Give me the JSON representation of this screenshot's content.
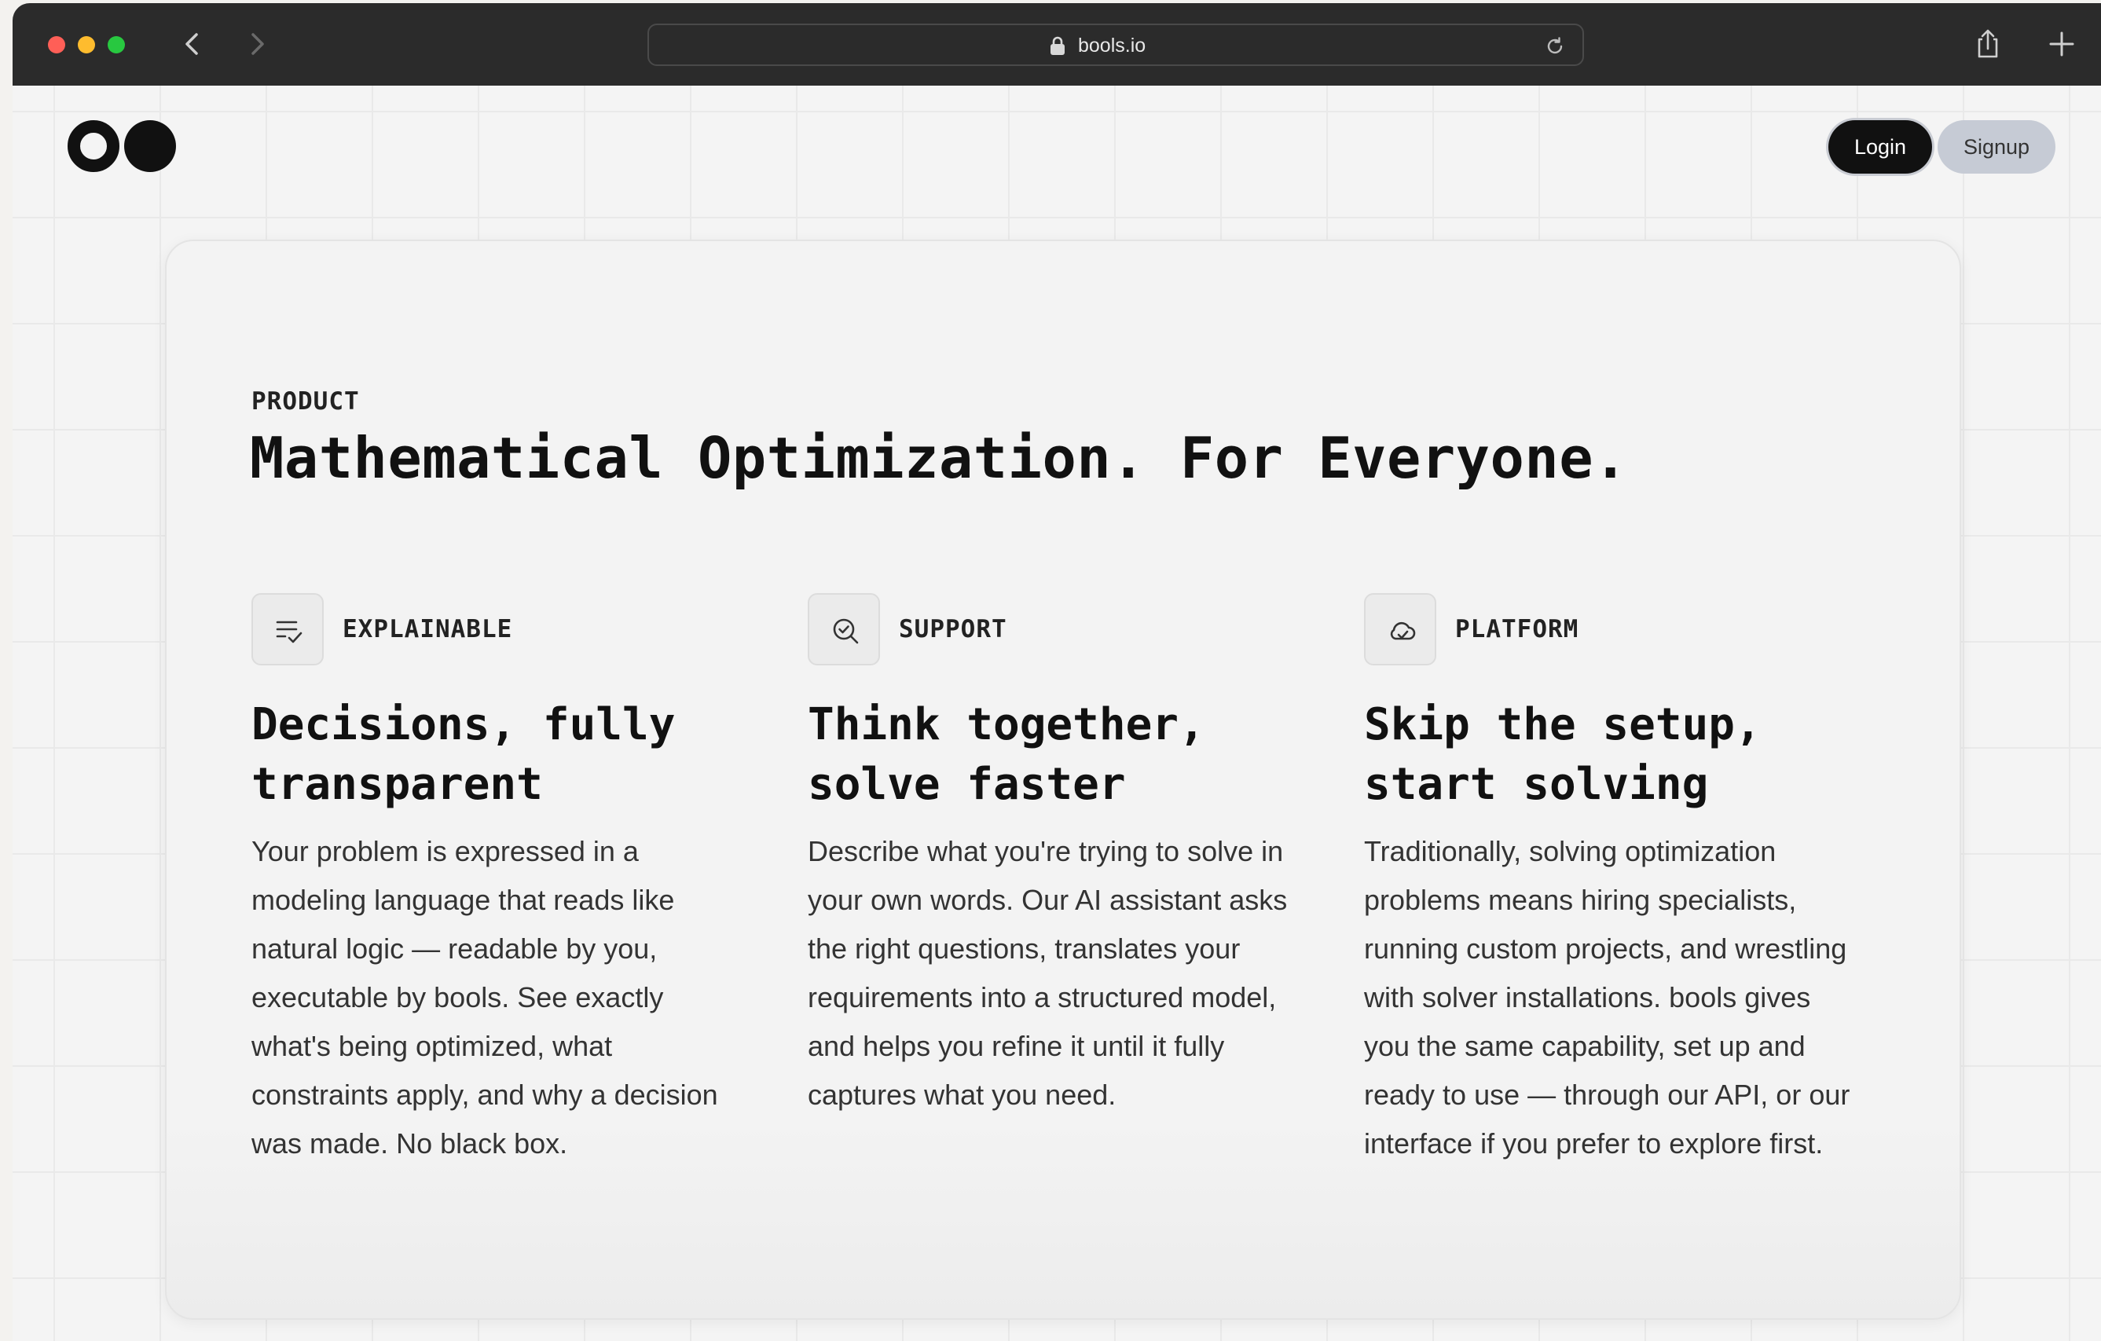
{
  "browser": {
    "url": "bools.io"
  },
  "header": {
    "login_label": "Login",
    "signup_label": "Signup"
  },
  "hero": {
    "eyebrow": "PRODUCT",
    "headline": "Mathematical Optimization. For Everyone."
  },
  "features": [
    {
      "icon": "list-check-icon",
      "label": "EXPLAINABLE",
      "title": "Decisions, fully transparent",
      "body": "Your problem is expressed in a modeling language that reads like natural logic — readable by you, executable by bools. See exactly what's being optimized, what constraints apply, and why a decision was made. No black box."
    },
    {
      "icon": "search-check-icon",
      "label": "SUPPORT",
      "title": "Think together, solve faster",
      "body": "Describe what you're trying to solve in your own words. Our AI assistant asks the right questions, translates your requirements into a structured model, and helps you refine it until it fully captures what you need."
    },
    {
      "icon": "cloud-icon",
      "label": "PLATFORM",
      "title": "Skip the setup, start solving",
      "body": "Traditionally, solving optimization problems means hiring specialists, running custom projects, and wrestling with solver installations. bools gives you the same capability, set up and ready to use — through our API, or our interface if you prefer to explore first."
    }
  ],
  "colors": {
    "page_background": "#f4f4f4",
    "chrome": "#2b2b2b",
    "primary_button": "#111111",
    "secondary_button": "#c6cbd5"
  }
}
